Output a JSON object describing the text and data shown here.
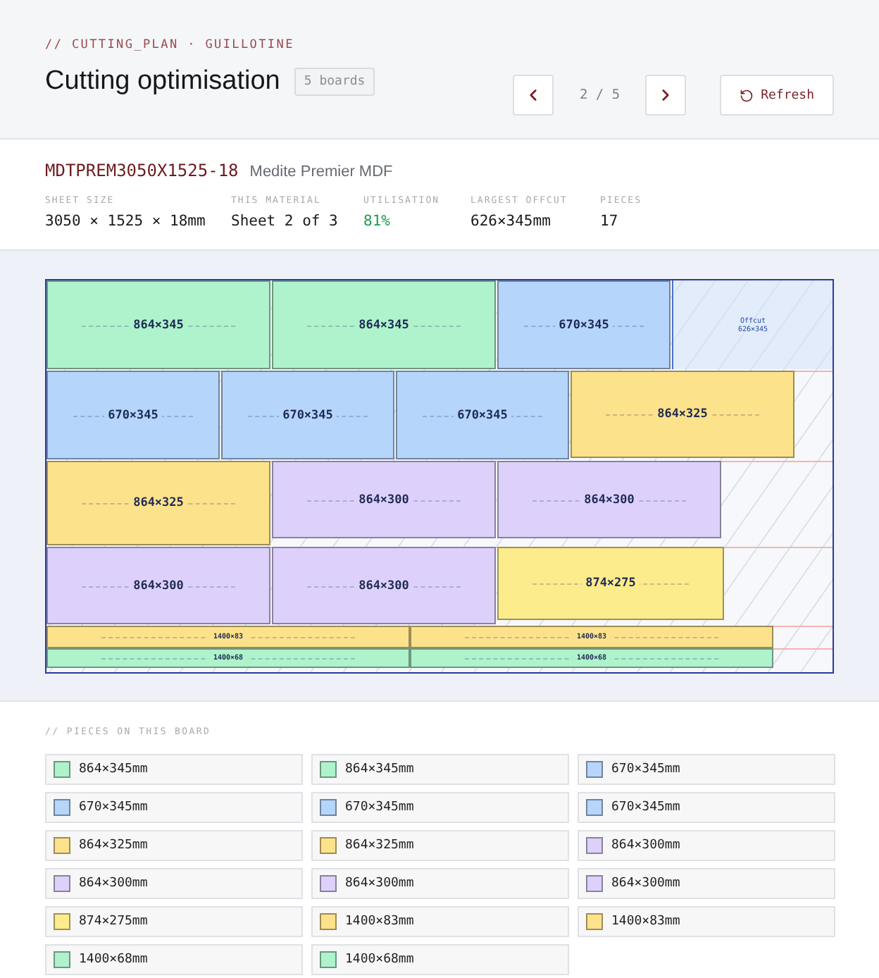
{
  "header": {
    "eyebrow": "// CUTTING_PLAN · GUILLOTINE",
    "title": "Cutting optimisation",
    "badge": "5 boards",
    "pager": "2 / 5",
    "refresh": "Refresh"
  },
  "material": {
    "code": "MDTPREM3050X1525-18",
    "name": "Medite Premier MDF",
    "stats": [
      {
        "label": "SHEET SIZE",
        "value": "3050 × 1525 × 18mm",
        "kind": "plain"
      },
      {
        "label": "THIS MATERIAL",
        "value": "Sheet 2 of 3",
        "kind": "plain"
      },
      {
        "label": "UTILISATION",
        "value": "81%",
        "kind": "good"
      },
      {
        "label": "LARGEST OFFCUT",
        "value": "626×345mm",
        "kind": "plain"
      },
      {
        "label": "PIECES",
        "value": "17",
        "kind": "plain"
      }
    ]
  },
  "board": {
    "offcut": {
      "title": "Offcut",
      "size": "626×345"
    },
    "pieces": [
      {
        "label": "864×345",
        "color": "#aef3cb"
      },
      {
        "label": "864×345",
        "color": "#aef3cb"
      },
      {
        "label": "670×345",
        "color": "#b5d5fb"
      },
      {
        "label": "670×345",
        "color": "#b5d5fb"
      },
      {
        "label": "670×345",
        "color": "#b5d5fb"
      },
      {
        "label": "670×345",
        "color": "#b5d5fb"
      },
      {
        "label": "864×325",
        "color": "#fde28c"
      },
      {
        "label": "864×325",
        "color": "#fde28c"
      },
      {
        "label": "864×300",
        "color": "#ddd1fb"
      },
      {
        "label": "864×300",
        "color": "#ddd1fb"
      },
      {
        "label": "864×300",
        "color": "#ddd1fb"
      },
      {
        "label": "864×300",
        "color": "#ddd1fb"
      },
      {
        "label": "874×275",
        "color": "#fdec8c"
      },
      {
        "label": "1400×83",
        "color": "#fde28c"
      },
      {
        "label": "1400×83",
        "color": "#fde28c"
      },
      {
        "label": "1400×68",
        "color": "#aef3cb"
      },
      {
        "label": "1400×68",
        "color": "#aef3cb"
      }
    ]
  },
  "pieces_list": {
    "title": "// PIECES ON THIS BOARD",
    "items": [
      {
        "label": "864×345mm",
        "color": "#aef3cb"
      },
      {
        "label": "864×345mm",
        "color": "#aef3cb"
      },
      {
        "label": "670×345mm",
        "color": "#b5d5fb"
      },
      {
        "label": "670×345mm",
        "color": "#b5d5fb"
      },
      {
        "label": "670×345mm",
        "color": "#b5d5fb"
      },
      {
        "label": "670×345mm",
        "color": "#b5d5fb"
      },
      {
        "label": "864×325mm",
        "color": "#fde28c"
      },
      {
        "label": "864×325mm",
        "color": "#fde28c"
      },
      {
        "label": "864×300mm",
        "color": "#ddd1fb"
      },
      {
        "label": "864×300mm",
        "color": "#ddd1fb"
      },
      {
        "label": "864×300mm",
        "color": "#ddd1fb"
      },
      {
        "label": "864×300mm",
        "color": "#ddd1fb"
      },
      {
        "label": "874×275mm",
        "color": "#fdec8c"
      },
      {
        "label": "1400×83mm",
        "color": "#fde28c"
      },
      {
        "label": "1400×83mm",
        "color": "#fde28c"
      },
      {
        "label": "1400×68mm",
        "color": "#aef3cb"
      },
      {
        "label": "1400×68mm",
        "color": "#aef3cb"
      }
    ]
  }
}
